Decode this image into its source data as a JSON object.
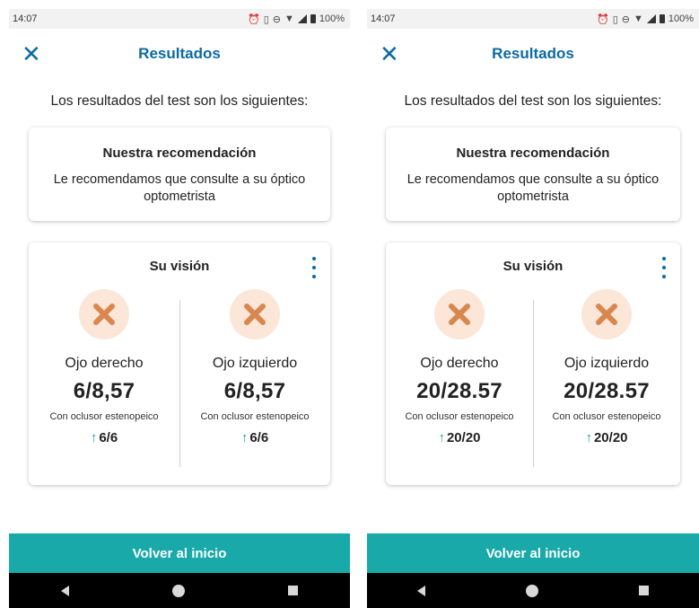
{
  "statusbar": {
    "time": "14:07",
    "battery": "100%"
  },
  "appbar": {
    "title": "Resultados"
  },
  "intro": "Los resultados del test son los siguientes:",
  "recommendation": {
    "title": "Nuestra recomendación",
    "body": "Le recomendamos que consulte a su óptico optometrista"
  },
  "vision": {
    "title": "Su visión",
    "left_eye_label": "Ojo derecho",
    "right_eye_label": "Ojo izquierdo",
    "note": "Con oclusor estenopeico"
  },
  "screens": [
    {
      "right_value": "6/8,57",
      "left_value": "6/8,57",
      "right_best": "6/6",
      "left_best": "6/6"
    },
    {
      "right_value": "20/28.57",
      "left_value": "20/28.57",
      "right_best": "20/20",
      "left_best": "20/20"
    }
  ],
  "footer": {
    "button_label": "Volver al inicio"
  },
  "colors": {
    "accent": "#0b6aa3",
    "button": "#1aa9a9",
    "arrow": "#17a39a",
    "x_icon": "#d8874f",
    "x_bg": "#fbe6d8"
  },
  "icons": {
    "close": "close-icon",
    "menu": "more-vertical-icon",
    "fail": "x-mark-icon",
    "improve": "arrow-up-icon"
  }
}
